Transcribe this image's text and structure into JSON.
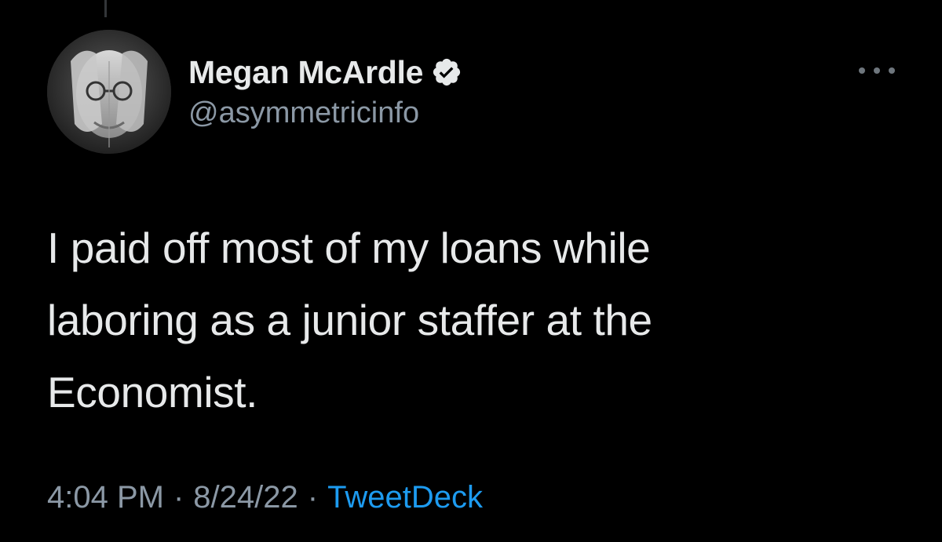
{
  "tweet": {
    "author": {
      "display_name": "Megan McArdle",
      "handle": "@asymmetricinfo",
      "verified": true,
      "verified_icon": "verified-badge-icon",
      "avatar": "profile-photo"
    },
    "text_lines": [
      "I paid off most of my loans while",
      "laboring as a junior staffer at the",
      "Economist."
    ],
    "meta": {
      "time": "4:04 PM",
      "separator": "·",
      "date": "8/24/22",
      "source": "TweetDeck"
    },
    "more_icon": "more-horizontal-icon"
  },
  "colors": {
    "background": "#000000",
    "primary_text": "#e7e9ea",
    "secondary_text": "#8b98a5",
    "link": "#1d9bf0"
  }
}
